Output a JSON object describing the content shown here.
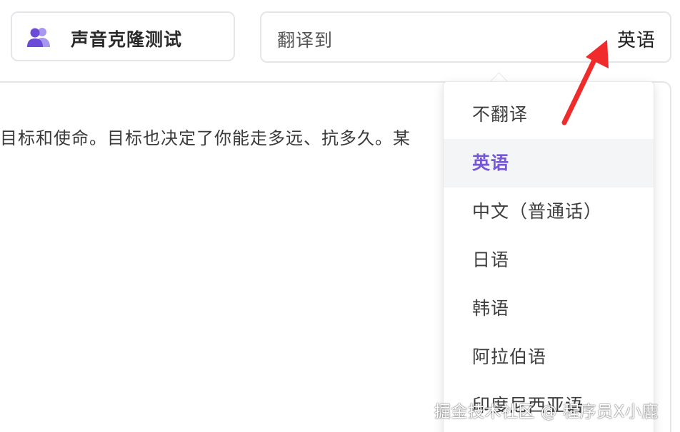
{
  "voice_card": {
    "label": "声音克隆测试",
    "icon": "users-icon",
    "icon_color": "#7a5ae0"
  },
  "translate_card": {
    "label": "翻译到",
    "selected_value": "英语"
  },
  "content": {
    "text": "目标和使命。目标也决定了你能走多远、抗多久。某"
  },
  "dropdown": {
    "items": [
      {
        "label": "不翻译"
      },
      {
        "label": "英语",
        "selected": true
      },
      {
        "label": "中文（普通话）"
      },
      {
        "label": "日语"
      },
      {
        "label": "韩语"
      },
      {
        "label": "阿拉伯语"
      },
      {
        "label": "印度尼西亚语"
      }
    ],
    "accent_color": "#7657d6"
  },
  "annotation": {
    "arrow": "red-arrow-icon",
    "arrow_color": "#f02b2b"
  },
  "watermark": {
    "text": "掘金技术社区 @ 程序员X小鹿"
  }
}
